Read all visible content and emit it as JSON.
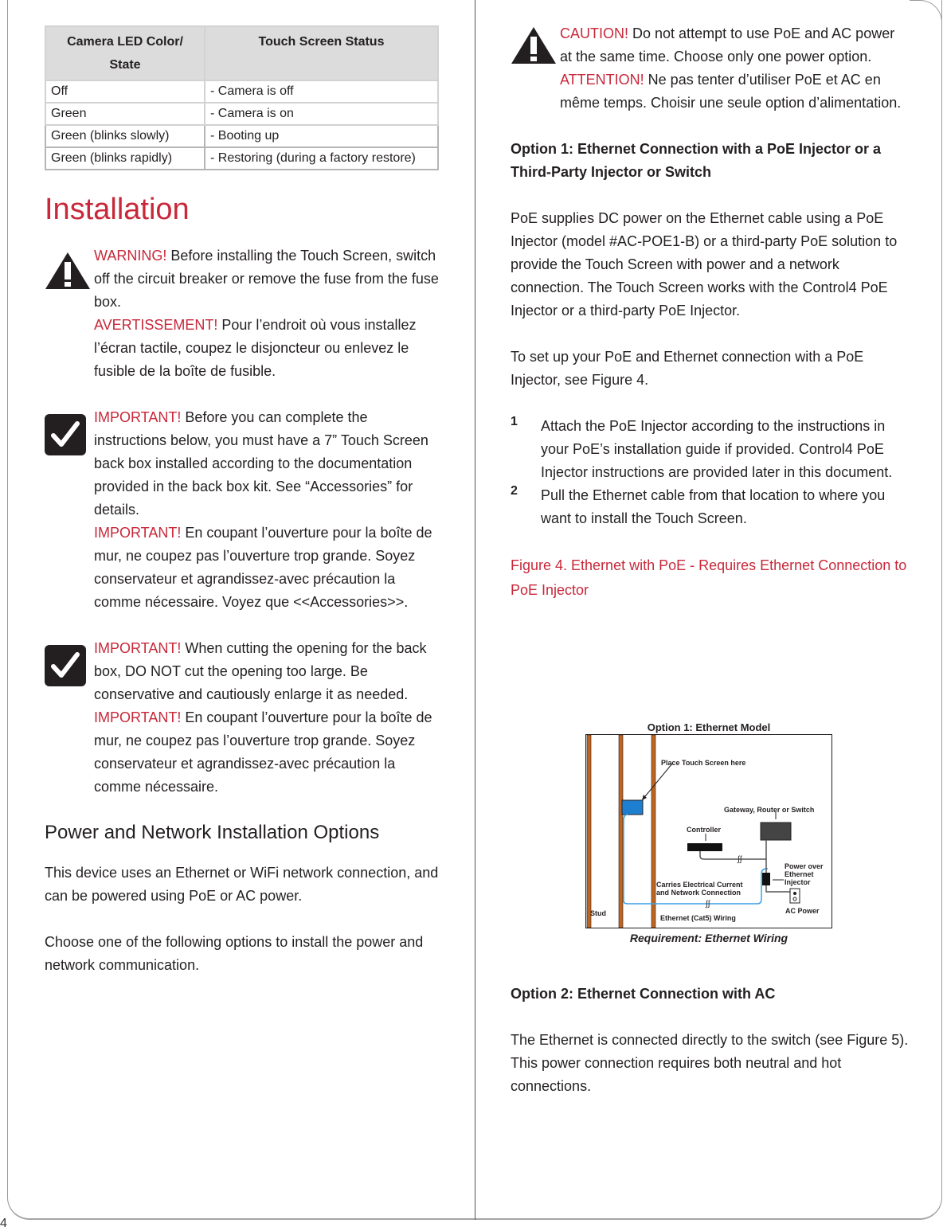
{
  "page_number": "4",
  "left": {
    "table": {
      "headers": [
        "Camera LED Color/ State",
        "Touch Screen Status"
      ],
      "rows": [
        [
          "Off",
          "- Camera is off"
        ],
        [
          "Green",
          "- Camera is on"
        ],
        [
          "Green (blinks slowly)",
          "- Booting up"
        ],
        [
          "Green  (blinks rapidly)",
          "- Restoring (during a factory restore)"
        ]
      ]
    },
    "section_title": "Installation",
    "warning": {
      "icon": "warning-triangle-icon",
      "label_en": "WARNING!",
      "text_en": " Before installing the Touch Screen, switch off the circuit breaker or remove the fuse from the fuse box.",
      "label_fr": "AVERTISSEMENT!",
      "text_fr": " Pour l’endroit où vous installez l’écran tactile, coupez le disjoncteur ou enlevez le fusible de la boîte de fusible."
    },
    "important1": {
      "icon": "checkmark-icon",
      "label_en": "IMPORTANT!",
      "text_en": "  Before you can complete the instructions below, you must have a 7” Touch Screen back box installed according to the documentation provided in the back box kit. See “Accessories” for details.",
      "label_fr": "IMPORTANT!",
      "text_fr": "  En coupant l’ouverture pour la boîte de mur, ne coupez pas l’ouverture trop grande. Soyez conservateur et agrandissez-avec précaution la comme nécessaire. Voyez que <<Accessories>>."
    },
    "important2": {
      "icon": "checkmark-icon",
      "label_en": "IMPORTANT!",
      "text_en": "  When cutting the opening for the back box, DO NOT cut the opening too large. Be conservative and cautiously enlarge it as needed.",
      "label_fr": "IMPORTANT!",
      "text_fr": "  En coupant l’ouverture pour la boîte de mur, ne coupez pas l’ouverture trop grande. Soyez conservateur et agrandissez-avec précaution la comme nécessaire."
    },
    "subsection_title": "Power and Network Installation Options",
    "para1": "This device uses an Ethernet or WiFi network connection, and can be powered using PoE or AC power.",
    "para2": "Choose one of the following options to install the power and network communication."
  },
  "right": {
    "caution": {
      "icon": "warning-triangle-icon",
      "label_en": "CAUTION!",
      "text_en": " Do not attempt to use PoE and AC power at the same time. Choose only one power option.",
      "label_fr": "ATTENTION!",
      "text_fr": " Ne pas tenter d’utiliser PoE et AC en même temps. Choisir une seule option d’alimentation."
    },
    "option1_heading": "Option 1: Ethernet Connection with a PoE Injector or a Third-Party Injector or Switch",
    "option1_para1": "PoE supplies DC power on the Ethernet cable using a PoE Injector (model #AC-POE1-B) or a third-party PoE solution to provide the Touch Screen with power and a network connection. The Touch Screen works with the Control4 PoE Injector or a third-party PoE Injector.",
    "option1_para2": "To set up your PoE and Ethernet connection with a PoE Injector, see Figure 4.",
    "steps": [
      {
        "num": "1",
        "text": "Attach the PoE Injector according to the instructions in your PoE’s installation guide if provided. Control4 PoE Injector instructions are provided later in this document."
      },
      {
        "num": "2",
        "text": "Pull the Ethernet cable from that location to where you want to install the Touch Screen."
      }
    ],
    "figure_caption": "Figure 4. Ethernet with PoE - Requires Ethernet Connection to PoE Injector",
    "figure": {
      "title": "Option 1: Ethernet Model",
      "labels": {
        "place": "Place  Touch Screen here",
        "gateway": "Gateway, Router or Switch",
        "controller": "Controller",
        "poe": "Power over Ethernet Injector",
        "carries": "Carries Electrical Current and Network Connection",
        "ac": "AC Power",
        "stud": "Stud",
        "ethernet": "Ethernet (Cat5) Wiring"
      },
      "requirement": "Requirement: Ethernet Wiring",
      "colors": {
        "stud": "#c0651f",
        "touchscreen": "#1e7fd0",
        "cable": "#3aa0e8",
        "gateway": "#444444"
      }
    },
    "option2_heading": "Option 2: Ethernet Connection with AC",
    "option2_para": "The Ethernet is connected directly to the switch (see Figure 5). This power connection requires both neutral and hot connections."
  }
}
